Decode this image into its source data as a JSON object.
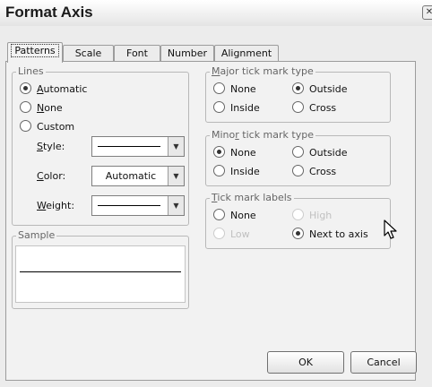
{
  "window": {
    "title": "Format Axis",
    "close_glyph": "✕"
  },
  "tabs": [
    {
      "label": "Patterns",
      "active": true
    },
    {
      "label": "Scale",
      "active": false
    },
    {
      "label": "Font",
      "active": false
    },
    {
      "label": "Number",
      "active": false
    },
    {
      "label": "Alignment",
      "active": false
    }
  ],
  "lines": {
    "legend": "Lines",
    "options": [
      {
        "access": "A",
        "rest": "utomatic",
        "selected": true
      },
      {
        "access": "N",
        "rest": "one",
        "selected": false
      },
      {
        "access": "",
        "rest": "Custom",
        "selected": false
      }
    ],
    "style_access": "S",
    "style_rest": "tyle:",
    "color_access": "C",
    "color_rest": "olor:",
    "color_value": "Automatic",
    "weight_access": "W",
    "weight_rest": "eight:"
  },
  "major_tick": {
    "legend_access": "M",
    "legend_rest": "ajor tick mark type",
    "options": [
      {
        "label": "None",
        "selected": false
      },
      {
        "label": "Outside",
        "selected": true
      },
      {
        "label": "Inside",
        "selected": false
      },
      {
        "label": "Cross",
        "selected": false
      }
    ]
  },
  "minor_tick": {
    "legend_pre": "Mino",
    "legend_access": "r",
    "legend_rest": " tick mark type",
    "options": [
      {
        "label": "None",
        "selected": true
      },
      {
        "label": "Outside",
        "selected": false
      },
      {
        "label": "Inside",
        "selected": false
      },
      {
        "label": "Cross",
        "selected": false
      }
    ]
  },
  "tick_labels": {
    "legend_access": "T",
    "legend_rest": "ick mark labels",
    "options": [
      {
        "label": "None",
        "selected": false,
        "enabled": true
      },
      {
        "label": "High",
        "selected": false,
        "enabled": false
      },
      {
        "label": "Low",
        "selected": false,
        "enabled": false
      },
      {
        "label": "Next to axis",
        "selected": true,
        "enabled": true
      }
    ]
  },
  "sample": {
    "legend": "Sample"
  },
  "buttons": {
    "ok": "OK",
    "cancel": "Cancel"
  },
  "icons": {
    "dropdown": "▼",
    "cursor": "arrow-cursor-icon"
  },
  "colors": {
    "dialog_bg": "#ececec",
    "panel_bg": "#f2f2f2",
    "legend_text": "#666666"
  }
}
